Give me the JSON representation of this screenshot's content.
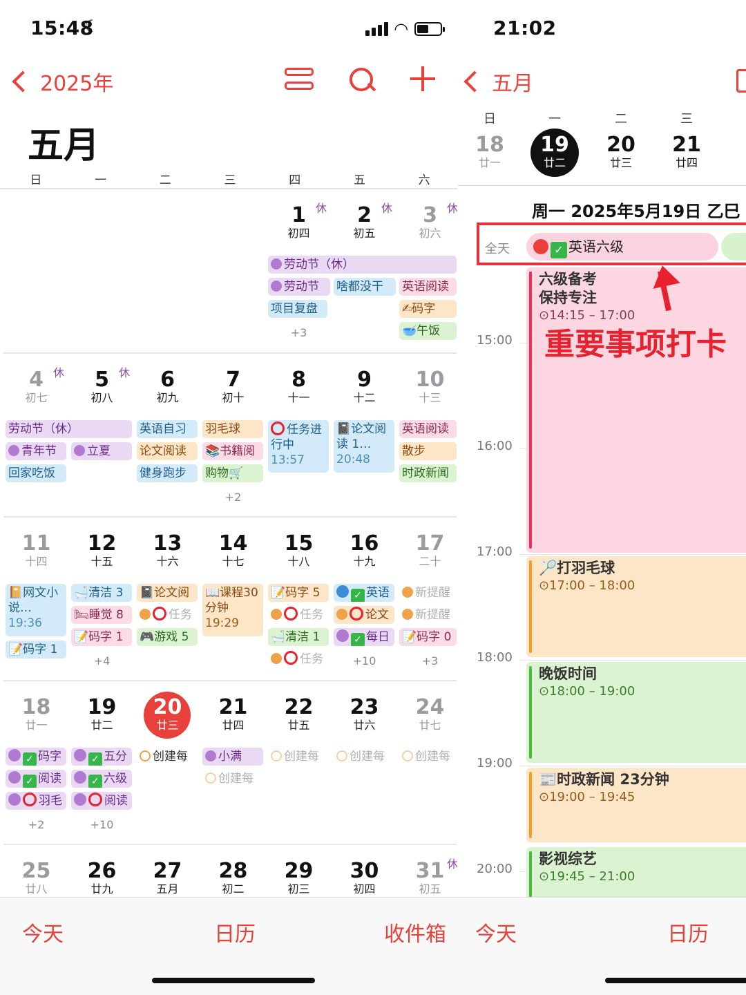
{
  "left": {
    "status": {
      "time": "15:48"
    },
    "nav": {
      "back_label": "2025年"
    },
    "month_title": "五月",
    "weekdays": [
      "日",
      "一",
      "二",
      "三",
      "四",
      "五",
      "六"
    ],
    "xiu": "休",
    "weeks": [
      {
        "days": [
          {
            "num": "",
            "lunar": ""
          },
          {
            "num": "",
            "lunar": ""
          },
          {
            "num": "",
            "lunar": ""
          },
          {
            "num": "",
            "lunar": ""
          },
          {
            "num": "1",
            "lunar": "初四"
          },
          {
            "num": "2",
            "lunar": "初五"
          },
          {
            "num": "3",
            "lunar": "初六"
          }
        ],
        "events": [
          "劳动节（休）",
          "劳动节",
          "啥都没干",
          "英语阅读",
          "项目复盘",
          "码字",
          "午饭"
        ],
        "more": "+3"
      },
      {
        "days": [
          {
            "num": "4",
            "lunar": "初七"
          },
          {
            "num": "5",
            "lunar": "初八"
          },
          {
            "num": "6",
            "lunar": "初九"
          },
          {
            "num": "7",
            "lunar": "初十"
          },
          {
            "num": "8",
            "lunar": "十一"
          },
          {
            "num": "9",
            "lunar": "十二"
          },
          {
            "num": "10",
            "lunar": "十三"
          }
        ],
        "events": [
          "劳动节（休）",
          "青年节",
          "立夏",
          "回家吃饭",
          "英语自习",
          "论文阅读",
          "健身跑步",
          "羽毛球",
          "书籍阅",
          "购物🛒",
          "任务进行中",
          "13:57",
          "论文阅读 1…",
          "20:48",
          "英语阅读",
          "散步",
          "时政新闻"
        ],
        "more": "+2"
      },
      {
        "days": [
          {
            "num": "11",
            "lunar": "十四"
          },
          {
            "num": "12",
            "lunar": "十五"
          },
          {
            "num": "13",
            "lunar": "十六"
          },
          {
            "num": "14",
            "lunar": "十七"
          },
          {
            "num": "15",
            "lunar": "十八"
          },
          {
            "num": "16",
            "lunar": "十九"
          },
          {
            "num": "17",
            "lunar": "二十"
          }
        ],
        "events": [
          "网文小说…",
          "19:36",
          "码字 1",
          "清洁 3",
          "睡觉 8",
          "码字 1",
          "论文阅",
          "任务",
          "游戏 5",
          "课程30分钟",
          "19:29",
          "码字 5",
          "任务",
          "清洁 1",
          "任务",
          "英语",
          "论文",
          "每日",
          "新提醒",
          "新提醒",
          "码字 0"
        ],
        "more": [
          "+4",
          "+10",
          "+3"
        ]
      },
      {
        "days": [
          {
            "num": "18",
            "lunar": "廿一"
          },
          {
            "num": "19",
            "lunar": "廿二"
          },
          {
            "num": "20",
            "lunar": "廿三"
          },
          {
            "num": "21",
            "lunar": "廿四"
          },
          {
            "num": "22",
            "lunar": "廿五"
          },
          {
            "num": "23",
            "lunar": "廿六"
          },
          {
            "num": "24",
            "lunar": "廿七"
          }
        ],
        "events": [
          "码字",
          "阅读",
          "羽毛",
          "五分",
          "六级",
          "阅读",
          "创建每",
          "小满",
          "创建每",
          "创建每",
          "创建每",
          "创建每"
        ],
        "more": [
          "+2",
          "+10"
        ]
      },
      {
        "days": [
          {
            "num": "25",
            "lunar": "廿八"
          },
          {
            "num": "26",
            "lunar": "廿九"
          },
          {
            "num": "27",
            "lunar": "五月"
          },
          {
            "num": "28",
            "lunar": "初二"
          },
          {
            "num": "29",
            "lunar": "初三"
          },
          {
            "num": "30",
            "lunar": "初四"
          },
          {
            "num": "31",
            "lunar": "初五"
          }
        ]
      }
    ],
    "tabs": {
      "today": "今天",
      "calendar": "日历",
      "inbox": "收件箱"
    }
  },
  "right": {
    "status": {
      "time": "21:02"
    },
    "nav": {
      "back_label": "五月"
    },
    "week": [
      {
        "wd": "日",
        "num": "18",
        "lunar": "廿一"
      },
      {
        "wd": "一",
        "num": "19",
        "lunar": "廿二"
      },
      {
        "wd": "二",
        "num": "20",
        "lunar": "廿三"
      },
      {
        "wd": "三",
        "num": "21",
        "lunar": "廿四"
      }
    ],
    "day_title": "周一 2025年5月19日  乙巳",
    "allday": {
      "label": "全天",
      "event": "英语六级"
    },
    "hours": [
      "15:00",
      "16:00",
      "17:00",
      "18:00",
      "19:00",
      "20:00"
    ],
    "events": [
      {
        "title": "六级备考\n保持专注",
        "time": "14:15 – 17:00",
        "color": "#fcd7e2"
      },
      {
        "title": "打羽毛球",
        "time": "17:00 – 18:00",
        "color": "#fde6c8"
      },
      {
        "title": "晚饭时间",
        "time": "18:00 – 19:00",
        "color": "#dcf3d2"
      },
      {
        "title": "时政新闻 23分钟",
        "time": "19:00 – 19:45",
        "color": "#fde6c8"
      },
      {
        "title": "影视综艺",
        "time": "19:45 – 21:00",
        "color": "#dcf3d2"
      }
    ],
    "annotation": "重要事项打卡",
    "tabs": {
      "today": "今天",
      "calendar": "日历"
    }
  },
  "colors": {
    "accent": "#e8413b",
    "annotation": "#e8212e"
  }
}
